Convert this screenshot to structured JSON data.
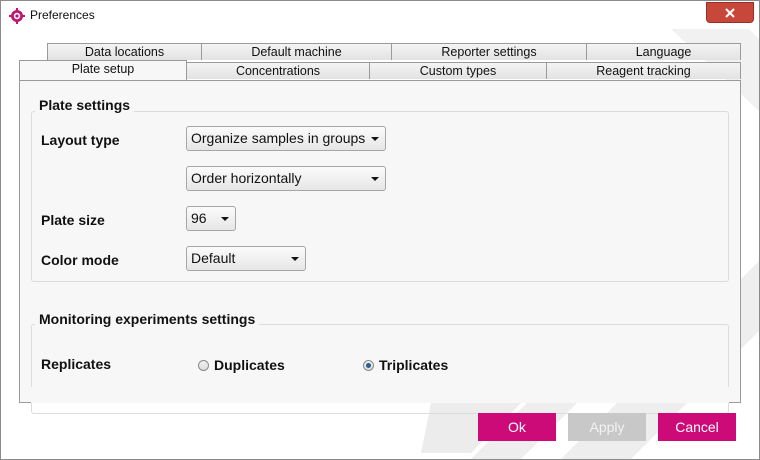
{
  "window": {
    "title": "Preferences"
  },
  "tabs_row1": [
    "Data locations",
    "Default machine",
    "Reporter settings",
    "Language"
  ],
  "tabs_row2": [
    "Plate setup",
    "Concentrations",
    "Custom types",
    "Reagent tracking"
  ],
  "active_tab": "Plate setup",
  "plate_settings": {
    "title": "Plate settings",
    "layout_type_label": "Layout type",
    "layout_type_value": "Organize samples in groups",
    "order_value": "Order horizontally",
    "plate_size_label": "Plate size",
    "plate_size_value": "96",
    "color_mode_label": "Color mode",
    "color_mode_value": "Default"
  },
  "monitoring": {
    "title": "Monitoring experiments settings",
    "replicates_label": "Replicates",
    "option_duplicates": "Duplicates",
    "option_triplicates": "Triplicates",
    "selected": "Triplicates"
  },
  "buttons": {
    "ok": "Ok",
    "apply": "Apply",
    "cancel": "Cancel"
  },
  "colors": {
    "accent": "#cc0a78",
    "close": "#c7473a",
    "disabled": "#c8c8c8"
  }
}
